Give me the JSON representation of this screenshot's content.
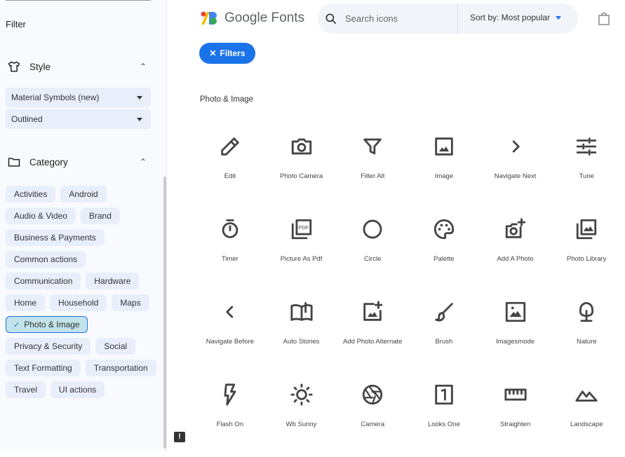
{
  "sidebar": {
    "filter_title": "Filter",
    "style": {
      "label": "Style",
      "icon": "shirt-icon",
      "selects": [
        "Material Symbols (new)",
        "Outlined"
      ]
    },
    "category": {
      "label": "Category",
      "icon": "folder-icon",
      "chips": [
        {
          "label": "Activities"
        },
        {
          "label": "Android"
        },
        {
          "label": "Audio & Video"
        },
        {
          "label": "Brand"
        },
        {
          "label": "Business & Payments"
        },
        {
          "label": "Common actions"
        },
        {
          "label": "Communication"
        },
        {
          "label": "Hardware"
        },
        {
          "label": "Home"
        },
        {
          "label": "Household"
        },
        {
          "label": "Maps"
        },
        {
          "label": "Photo & Image",
          "selected": true
        },
        {
          "label": "Privacy & Security"
        },
        {
          "label": "Social"
        },
        {
          "label": "Text Formatting"
        },
        {
          "label": "Transportation"
        },
        {
          "label": "Travel"
        },
        {
          "label": "UI actions"
        }
      ]
    }
  },
  "header": {
    "logo_text": "Google Fonts",
    "search_placeholder": "Search icons",
    "sort_label": "Sort by: Most popular",
    "filters_label": "Filters"
  },
  "main": {
    "section_title": "Photo & Image",
    "icons": [
      {
        "name": "Edit",
        "icon": "edit"
      },
      {
        "name": "Photo Camera",
        "icon": "photo_camera"
      },
      {
        "name": "Filter Alt",
        "icon": "filter_alt"
      },
      {
        "name": "Image",
        "icon": "image"
      },
      {
        "name": "Navigate Next",
        "icon": "navigate_next"
      },
      {
        "name": "Tune",
        "icon": "tune"
      },
      {
        "name": "Timer",
        "icon": "timer"
      },
      {
        "name": "Picture As Pdf",
        "icon": "picture_as_pdf"
      },
      {
        "name": "Circle",
        "icon": "circle"
      },
      {
        "name": "Palette",
        "icon": "palette"
      },
      {
        "name": "Add A Photo",
        "icon": "add_a_photo"
      },
      {
        "name": "Photo Library",
        "icon": "photo_library"
      },
      {
        "name": "Navigate Before",
        "icon": "navigate_before"
      },
      {
        "name": "Auto Stories",
        "icon": "auto_stories"
      },
      {
        "name": "Add Photo Alternate",
        "icon": "add_photo_alternate"
      },
      {
        "name": "Brush",
        "icon": "brush"
      },
      {
        "name": "Imagesmode",
        "icon": "imagesmode"
      },
      {
        "name": "Nature",
        "icon": "nature"
      },
      {
        "name": "Flash On",
        "icon": "flash_on"
      },
      {
        "name": "Wb Sunny",
        "icon": "wb_sunny"
      },
      {
        "name": "Camera",
        "icon": "camera"
      },
      {
        "name": "Looks One",
        "icon": "looks_one"
      },
      {
        "name": "Straighten",
        "icon": "straighten"
      },
      {
        "name": "Landscape",
        "icon": "landscape"
      }
    ]
  },
  "colors": {
    "accent": "#1a73e8",
    "sidebar_bg": "#f8fafd",
    "chip_bg": "#e8effb",
    "chip_selected_bg": "#c2e3ea"
  }
}
